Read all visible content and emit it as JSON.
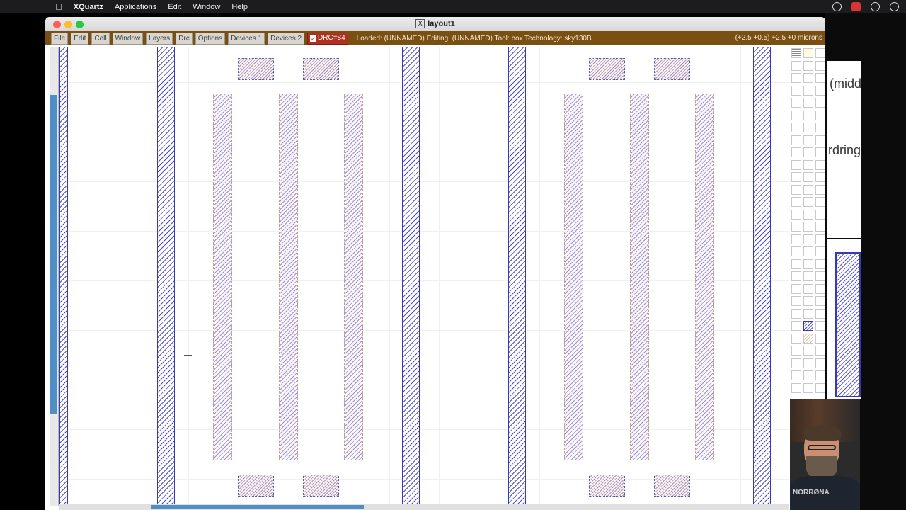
{
  "menubar": {
    "app": "XQuartz",
    "items": [
      "Applications",
      "Edit",
      "Window",
      "Help"
    ]
  },
  "background": {
    "text1": "(midd",
    "text2": "rdring"
  },
  "window": {
    "title": "layout1",
    "toolbar": {
      "buttons": [
        "File",
        "Edit",
        "Cell",
        "Window",
        "Layers",
        "Drc",
        "Options",
        "Devices 1",
        "Devices 2"
      ],
      "drc_label": "DRC=84",
      "status": "Loaded: (UNNAMED) Editing: (UNNAMED) Tool: box  Technology: sky130B",
      "coords": "(+2.5 +0.5) +2.5 +0 microns"
    }
  },
  "webcam": {
    "shirt_text": "NORRØNA"
  },
  "colors": {
    "toolbar": "#7a4f12",
    "drc_badge": "#b03020",
    "metal_stripe": "#4b4bc8",
    "scroll_thumb": "#4f8fc6"
  }
}
